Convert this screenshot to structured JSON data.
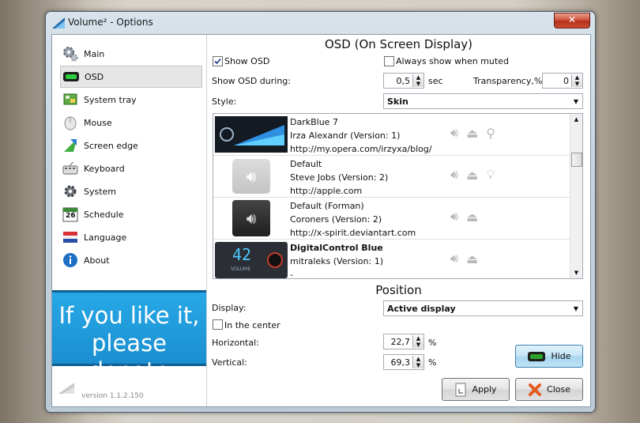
{
  "window": {
    "title": "Volume² - Options",
    "close_label": "✕"
  },
  "sidebar": {
    "items": [
      {
        "label": "Main",
        "icon": "gear-icon"
      },
      {
        "label": "OSD",
        "icon": "osd-icon"
      },
      {
        "label": "System tray",
        "icon": "system-tray-icon"
      },
      {
        "label": "Mouse",
        "icon": "mouse-icon"
      },
      {
        "label": "Screen edge",
        "icon": "screen-edge-icon"
      },
      {
        "label": "Keyboard",
        "icon": "keyboard-icon"
      },
      {
        "label": "System",
        "icon": "system-icon"
      },
      {
        "label": "Schedule",
        "icon": "calendar-icon"
      },
      {
        "label": "Language",
        "icon": "language-icon"
      },
      {
        "label": "About",
        "icon": "info-icon"
      }
    ],
    "selected": "OSD",
    "donate": "If you like it, please donate",
    "version": "version 1.1.2.150",
    "calendar_day": "26"
  },
  "osd": {
    "header": "OSD (On Screen Display)",
    "show_osd": {
      "label": "Show OSD",
      "checked": true
    },
    "always_muted": {
      "label": "Always show when muted",
      "checked": false
    },
    "during_label": "Show OSD during:",
    "during_value": "0,5",
    "during_unit": "sec",
    "transparency_label": "Transparency,%:",
    "transparency_value": "0",
    "style_label": "Style:",
    "style_value": "Skin",
    "skins": [
      {
        "name": "DarkBlue 7",
        "author": "Irza Alexandr (Version: 1)",
        "url": "http://my.opera.com/irzyxa/blog/",
        "bold": false,
        "extra_icon": "usb-icon"
      },
      {
        "name": "Default",
        "author": "Steve Jobs (Version: 2)",
        "url": "http://apple.com",
        "bold": false,
        "extra_icon": "bulb-icon"
      },
      {
        "name": "Default (Forman)",
        "author": "Coroners (Version: 2)",
        "url": "http://x-spirit.deviantart.com",
        "bold": false,
        "extra_icon": ""
      },
      {
        "name": "DigitalControl Blue",
        "author": "mitraleks (Version: 1)",
        "url": "-",
        "bold": true,
        "extra_icon": ""
      }
    ],
    "digital_text": "42",
    "digital_label": "VOLUME"
  },
  "position": {
    "header": "Position",
    "display_label": "Display:",
    "display_value": "Active display",
    "center": {
      "label": "In the center",
      "checked": false
    },
    "horizontal_label": "Horizontal:",
    "horizontal_value": "22,7",
    "vertical_label": "Vertical:",
    "vertical_value": "69,3",
    "unit": "%"
  },
  "buttons": {
    "hide": "Hide",
    "apply": "Apply",
    "close": "Close"
  },
  "colors": {
    "accent": "#1b8fd0",
    "green": "#2aa52a",
    "close_x": "#e35b1e"
  }
}
